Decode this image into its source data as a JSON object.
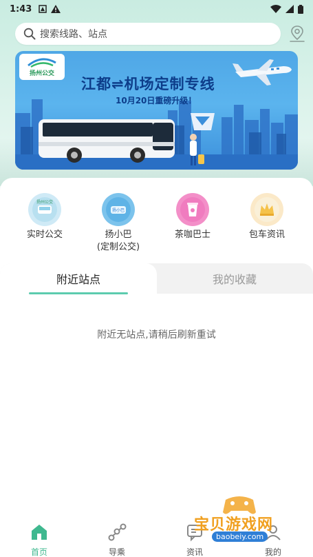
{
  "status_bar": {
    "time": "1:43"
  },
  "search": {
    "placeholder": "搜索线路、站点"
  },
  "banner": {
    "logo_text": "扬州公交",
    "title": "江都⇌机场定制专线",
    "subtitle": "10月20日重磅升级！"
  },
  "quick_entries": [
    {
      "label": "实时公交",
      "color": "#bfe3f3"
    },
    {
      "label": "扬小巴\n(定制公交)",
      "label_line1": "扬小巴",
      "label_line2": "(定制公交)",
      "color": "#7cc3ec"
    },
    {
      "label": "茶咖巴士",
      "color": "#f38fc8"
    },
    {
      "label": "包车资讯",
      "color": "#fbe9c8"
    }
  ],
  "tabs": [
    {
      "label": "附近站点",
      "active": true
    },
    {
      "label": "我的收藏",
      "active": false
    }
  ],
  "empty_message": "附近无站点,请稍后刷新重试",
  "bottom_nav": [
    {
      "label": "首页",
      "icon": "home-icon",
      "active": true
    },
    {
      "label": "导乘",
      "icon": "route-icon",
      "active": false
    },
    {
      "label": "资讯",
      "icon": "news-icon",
      "active": false
    },
    {
      "label": "我的",
      "icon": "profile-icon",
      "active": false
    }
  ],
  "watermark": {
    "text": "宝贝游戏网",
    "url": "baobeiy.com"
  },
  "colors": {
    "accent": "#5ccbae",
    "nav_active": "#3fb88f",
    "header_bg": "#d6f1e8",
    "banner_bg": "#4fa7e6"
  }
}
